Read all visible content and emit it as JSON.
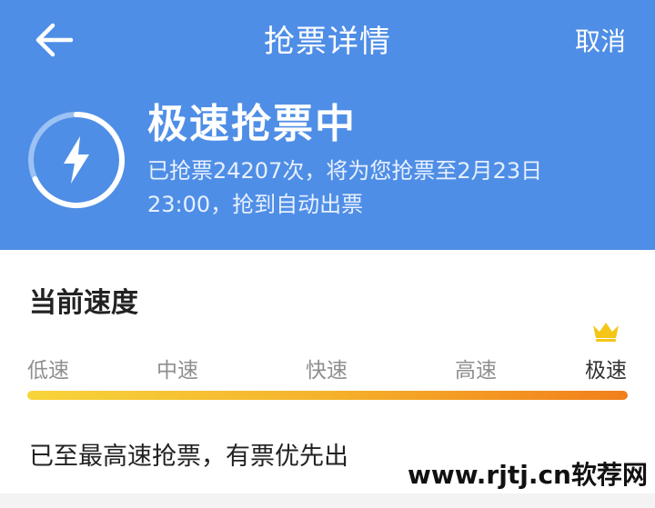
{
  "header": {
    "title": "抢票详情",
    "cancel_label": "取消",
    "back_icon": "arrow-left-icon"
  },
  "status": {
    "title": "极速抢票中",
    "description": "已抢票24207次，将为您抢票至2月23日 23:00，抢到自动出票",
    "icon": "lightning-icon"
  },
  "speed": {
    "title": "当前速度",
    "levels": [
      "低速",
      "中速",
      "快速",
      "高速",
      "极速"
    ],
    "current_level": "极速",
    "crown_icon": "crown-icon",
    "note": "已至最高速抢票，有票优先出"
  },
  "watermark": "www.rjtj.cn软荐网",
  "colors": {
    "header_bg": "#4f8ee6",
    "bar_start": "#f7d43a",
    "bar_end": "#f17f1b",
    "crown": "#f5c518"
  }
}
